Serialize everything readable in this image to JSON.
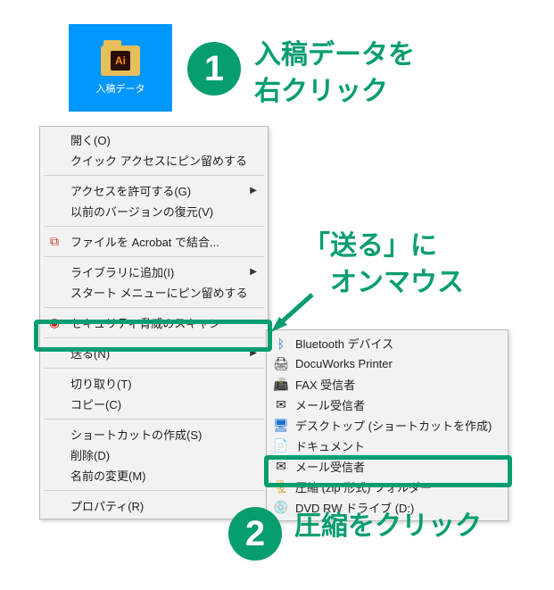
{
  "desktop": {
    "ai_mark": "Ai",
    "folder_label": "入稿データ"
  },
  "step1": {
    "num": "1",
    "text": "入稿データを\n右クリック"
  },
  "hint_sendto": "「送る」に\n　オンマウス",
  "step2": {
    "num": "2",
    "text": "圧縮をクリック"
  },
  "main_menu": {
    "open": "開く(O)",
    "pin_quick_access": "クイック アクセスにピン留めする",
    "grant_access": "アクセスを許可する(G)",
    "restore_previous": "以前のバージョンの復元(V)",
    "combine_acrobat": "ファイルを Acrobat で結合...",
    "add_library": "ライブラリに追加(I)",
    "pin_start": "スタート メニューにピン留めする",
    "security_scan": "セキュリティ脅威のスキャン",
    "send_to": "送る(N)",
    "cut": "切り取り(T)",
    "copy": "コピー(C)",
    "create_shortcut": "ショートカットの作成(S)",
    "delete": "削除(D)",
    "rename": "名前の変更(M)",
    "property": "プロパティ(R)"
  },
  "sub_menu": {
    "bluetooth": "Bluetooth デバイス",
    "docuworks": "DocuWorks Printer",
    "fax": "FAX 受信者",
    "mail": "メール受信者",
    "desktop_shortcut": "デスクトップ (ショートカットを作成)",
    "documents": "ドキュメント",
    "mail2": "メール受信者",
    "zip": "圧縮 (zip 形式) フォルダー",
    "dvd": "DVD RW ドライブ (D:)"
  }
}
